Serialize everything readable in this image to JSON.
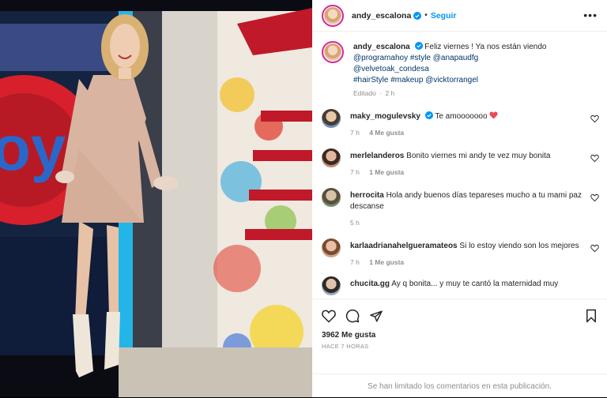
{
  "header": {
    "username": "andy_escalona",
    "separator": "•",
    "follow_label": "Seguir",
    "more_label": "•••"
  },
  "caption": {
    "username": "andy_escalona",
    "text": "Feliz viernes ! Ya nos están viendo",
    "tags_line1": "@programahoy #style @anapaudfg",
    "tags_line2": "@velvetoak_condesa",
    "tags_line3": "#hairStyle #makeup @vicktorrangel",
    "edited_label": "Editado",
    "separator": "·",
    "age": "2 h"
  },
  "comments": [
    {
      "username": "maky_mogulevsky",
      "text": "Te amooooooo",
      "verified": true,
      "time": "7 h",
      "likes": "4 Me gusta"
    },
    {
      "username": "merlelanderos",
      "text": "Bonito viernes mi andy te vez muy bonita",
      "time": "7 h",
      "likes": "1 Me gusta"
    },
    {
      "username": "herrocita",
      "text": "Hola andy buenos días tepareses mucho a tu mami paz descanse",
      "time": "5 h",
      "likes": ""
    },
    {
      "username": "karlaadrianahelgueramateos",
      "text": "Si lo estoy viendo son los mejores",
      "time": "7 h",
      "likes": "1 Me gusta"
    },
    {
      "username": "chucita.gg",
      "text": "Ay q bonita... y muy te cantó la maternidad muy",
      "time": "",
      "likes": ""
    }
  ],
  "footer": {
    "likes_count": "3962 Me gusta",
    "time_ago": "HACE 7 HORAS",
    "comments_limited": "Se han limitado los comentarios en esta publicación."
  },
  "colors": {
    "accent": "#0095f6",
    "link": "#00376b",
    "muted": "#8e8e8e",
    "heart_red": "#ed4956",
    "text": "#262626"
  }
}
